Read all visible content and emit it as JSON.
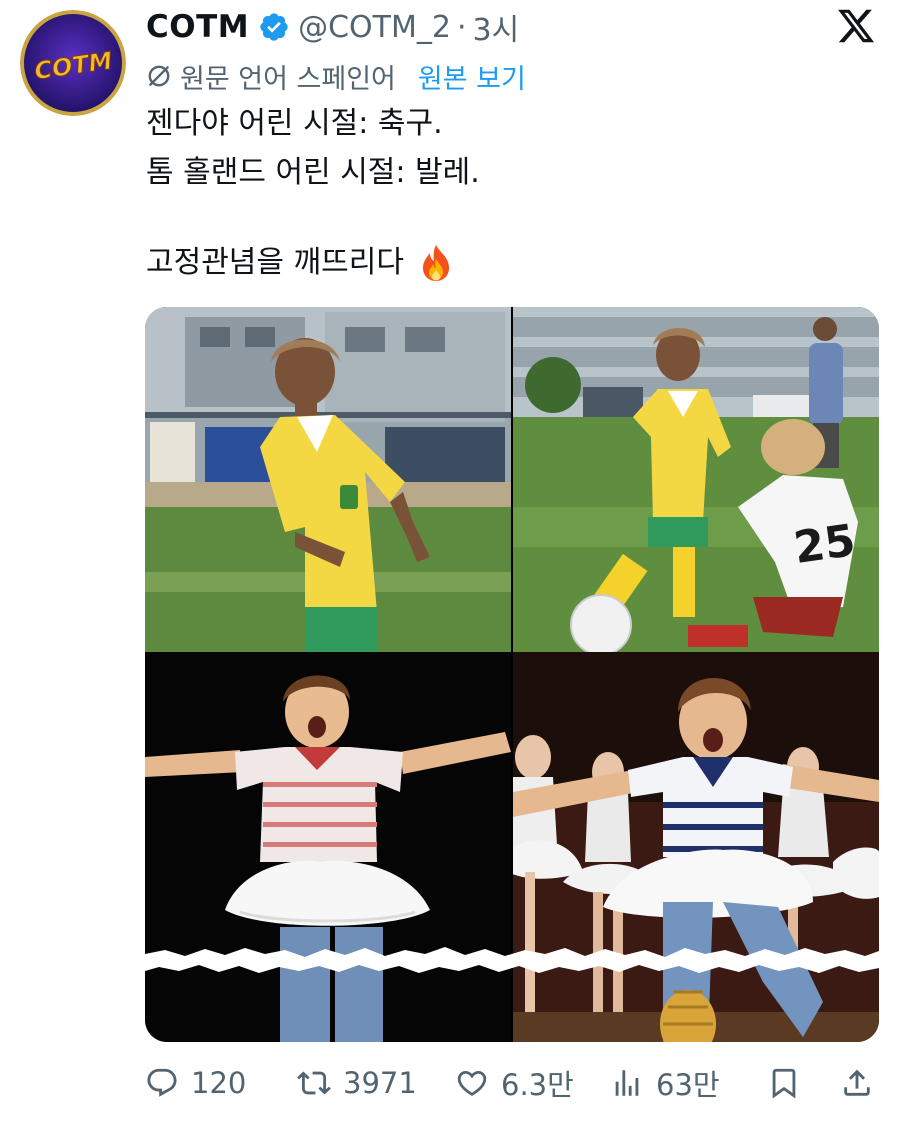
{
  "header": {
    "display_name": "COTM",
    "handle": "@COTM_2",
    "separator": "·",
    "time": "3시",
    "avatar_text": "COTM"
  },
  "translation": {
    "label": "원문 언어 스페인어",
    "show_original": "원본 보기"
  },
  "tweet": {
    "lines": [
      "젠다야 어린 시절: 축구.",
      "톰 홀랜드 어린 시절: 발레.",
      "고정관념을 깨뜨리다"
    ]
  },
  "media": {
    "panels": [
      {
        "name": "girl-soccer-photo"
      },
      {
        "name": "soccer-match-photo"
      },
      {
        "name": "boy-ballet-photo"
      },
      {
        "name": "boy-stage-dance-photo"
      }
    ],
    "jersey_number": "25"
  },
  "actions": {
    "replies": "120",
    "reposts": "3971",
    "likes": "6.3만",
    "views": "63만"
  },
  "colors": {
    "text": "#0f1419",
    "secondary": "#536471",
    "link": "#1d9bf0",
    "verified": "#1d9bf0",
    "avatar_bg": "#3b1f8f",
    "avatar_text": "#f5b82e"
  },
  "icons": [
    "verified-badge-icon",
    "x-logo-icon",
    "translate-icon",
    "fire-icon",
    "reply-icon",
    "repost-icon",
    "like-icon",
    "views-icon",
    "bookmark-icon",
    "share-icon"
  ]
}
